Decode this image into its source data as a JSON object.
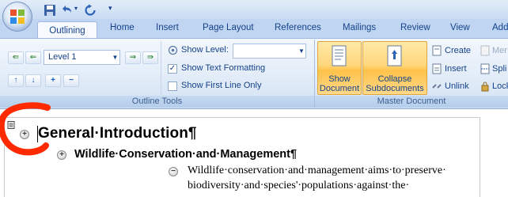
{
  "window": {
    "qat": {
      "save_icon": "save-icon",
      "undo_icon": "undo-icon",
      "redo_icon": "redo-icon",
      "customize_icon": "chevron-down-icon"
    }
  },
  "tabs": [
    "Outlining",
    "Home",
    "Insert",
    "Page Layout",
    "References",
    "Mailings",
    "Review",
    "View",
    "Add"
  ],
  "ribbon": {
    "outline_tools": {
      "title": "Outline Tools",
      "level_value": "Level 1",
      "show_level_label": "Show Level:",
      "show_level_value": "",
      "show_text_formatting": "Show Text Formatting",
      "show_text_formatting_checked": true,
      "show_first_line_only": "Show First Line Only",
      "show_first_line_only_checked": false
    },
    "master_document": {
      "title": "Master Document",
      "show_document": [
        "Show",
        "Document"
      ],
      "collapse_subdocuments": [
        "Collapse",
        "Subdocuments"
      ],
      "create": "Create",
      "merge": "Mer",
      "insert": "Insert",
      "split": "Spli",
      "unlink": "Unlink",
      "lock": "Lock"
    }
  },
  "document": {
    "heading1": "General·Introduction¶",
    "heading2": "Wildlife·Conservation·and·Management¶",
    "body_line1": "Wildlife·conservation·and·management·aims·to·preserve·",
    "body_line2": "biodiversity·and·species'·populations·against·the·"
  },
  "colors": {
    "ribbon_text": "#15428b",
    "active_button": "#ffd67b",
    "annotation_red": "#ff2a00"
  }
}
